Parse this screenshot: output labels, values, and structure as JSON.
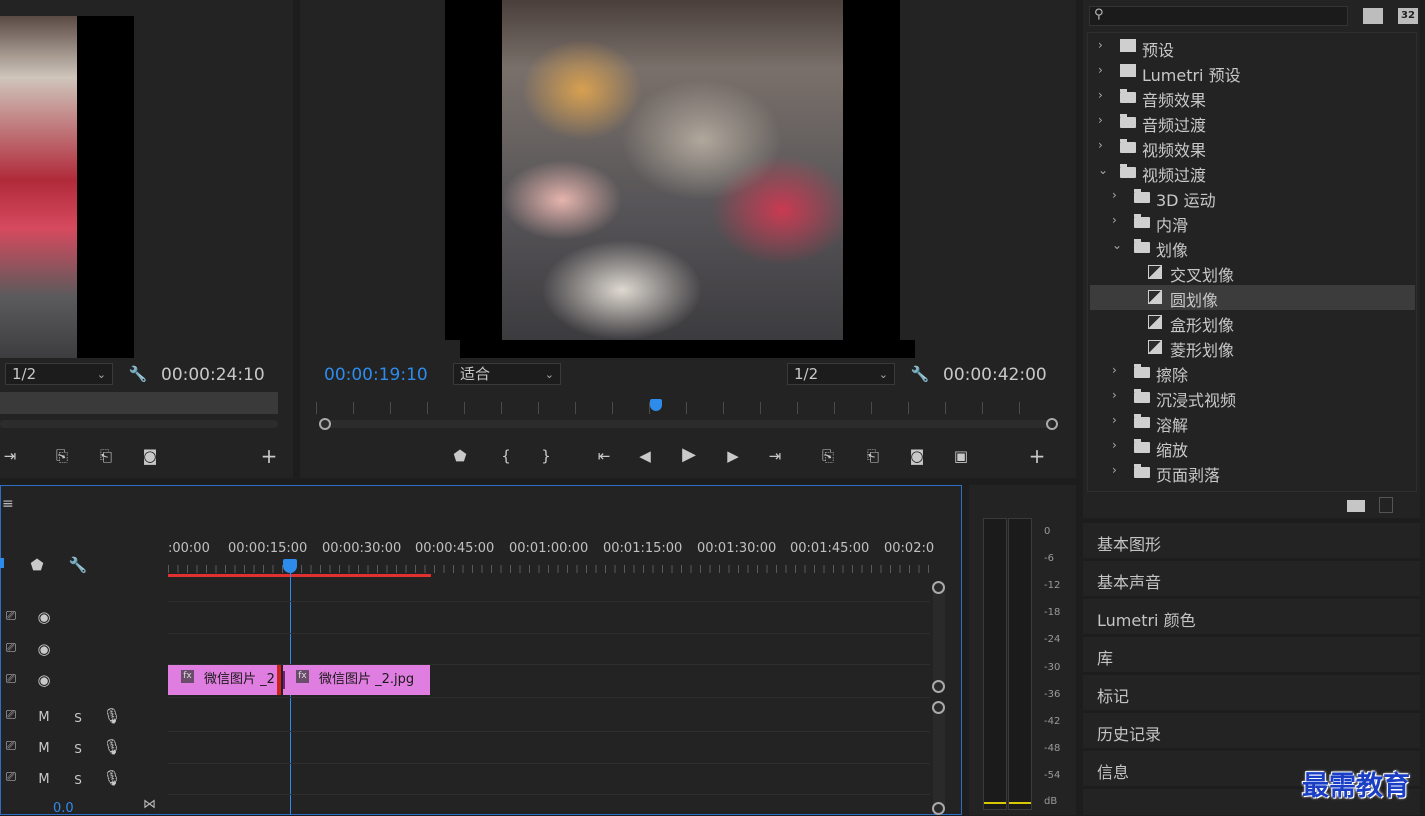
{
  "source_monitor": {
    "scale": "1/2",
    "duration": "00:00:24:10"
  },
  "program_monitor": {
    "current_time": "00:00:19:10",
    "fit": "适合",
    "scale": "1/2",
    "duration": "00:00:42:00"
  },
  "effects": {
    "search_placeholder": "",
    "badge_icon_label": "32",
    "tree": [
      {
        "label": "预设",
        "level": 0,
        "kind": "preset",
        "expanded": false
      },
      {
        "label": "Lumetri 预设",
        "level": 0,
        "kind": "preset",
        "expanded": false
      },
      {
        "label": "音频效果",
        "level": 0,
        "kind": "folder",
        "expanded": false
      },
      {
        "label": "音频过渡",
        "level": 0,
        "kind": "folder",
        "expanded": false
      },
      {
        "label": "视频效果",
        "level": 0,
        "kind": "folder",
        "expanded": false
      },
      {
        "label": "视频过渡",
        "level": 0,
        "kind": "folder",
        "expanded": true
      },
      {
        "label": "3D 运动",
        "level": 1,
        "kind": "folder",
        "expanded": false
      },
      {
        "label": "内滑",
        "level": 1,
        "kind": "folder",
        "expanded": false
      },
      {
        "label": "划像",
        "level": 1,
        "kind": "folder",
        "expanded": true
      },
      {
        "label": "交叉划像",
        "level": 2,
        "kind": "transition"
      },
      {
        "label": "圆划像",
        "level": 2,
        "kind": "transition",
        "selected": true
      },
      {
        "label": "盒形划像",
        "level": 2,
        "kind": "transition"
      },
      {
        "label": "菱形划像",
        "level": 2,
        "kind": "transition"
      },
      {
        "label": "擦除",
        "level": 1,
        "kind": "folder",
        "expanded": false
      },
      {
        "label": "沉浸式视频",
        "level": 1,
        "kind": "folder",
        "expanded": false
      },
      {
        "label": "溶解",
        "level": 1,
        "kind": "folder",
        "expanded": false
      },
      {
        "label": "缩放",
        "level": 1,
        "kind": "folder",
        "expanded": false
      },
      {
        "label": "页面剥落",
        "level": 1,
        "kind": "folder",
        "expanded": false
      }
    ]
  },
  "side_panels": [
    "基本图形",
    "基本声音",
    "Lumetri 颜色",
    "库",
    "标记",
    "历史记录",
    "信息"
  ],
  "timeline": {
    "ruler": [
      ":00:00",
      "00:00:15:00",
      "00:00:30:00",
      "00:00:45:00",
      "00:01:00:00",
      "00:01:15:00",
      "00:01:30:00",
      "00:01:45:00",
      "00:02:0"
    ],
    "clips": [
      {
        "label": "微信图片 _2"
      },
      {
        "label": "微信图片 _2.jpg"
      }
    ],
    "audio_m": "M",
    "audio_s": "S",
    "volume": "0.0"
  },
  "meter": {
    "labels": [
      "0",
      "-6",
      "-12",
      "-18",
      "-24",
      "-30",
      "-36",
      "-42",
      "-48",
      "-54",
      "dB"
    ]
  },
  "watermark": "最需教育",
  "colors": {
    "accent_blue": "#2d8ceb",
    "clip_pink": "#e07de0",
    "playhead_red": "#e03030"
  }
}
